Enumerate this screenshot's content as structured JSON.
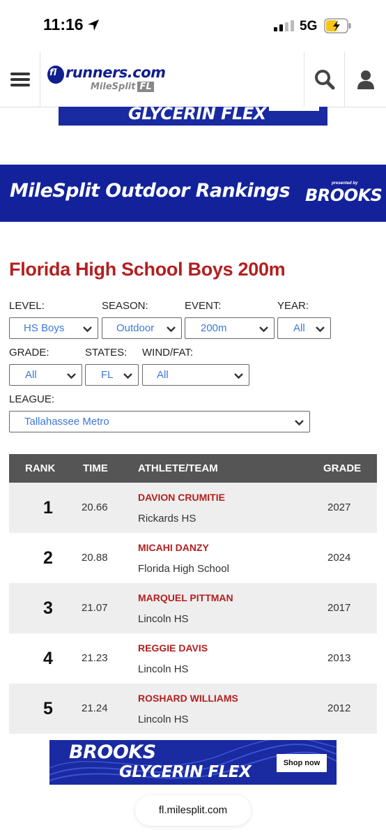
{
  "status_bar": {
    "time": "11:16",
    "network": "5G"
  },
  "header": {
    "logo_main": "runners.com",
    "logo_prefix": "fl",
    "logo_sub": "MileSplit",
    "logo_sub_badge": "FL"
  },
  "ad_top": {
    "text": "GLYCERIN FLEX"
  },
  "banner": {
    "title": "MileSplit Outdoor Rankings",
    "presented": "presented by",
    "brand": "BROOKS"
  },
  "page_title": "Florida High School Boys 200m",
  "filters": {
    "level": {
      "label": "LEVEL:",
      "value": "HS Boys"
    },
    "season": {
      "label": "SEASON:",
      "value": "Outdoor"
    },
    "event": {
      "label": "EVENT:",
      "value": "200m"
    },
    "year": {
      "label": "YEAR:",
      "value": "All"
    },
    "grade": {
      "label": "GRADE:",
      "value": "All"
    },
    "states": {
      "label": "STATES:",
      "value": "FL"
    },
    "wind": {
      "label": "WIND/FAT:",
      "value": "All"
    },
    "league": {
      "label": "LEAGUE:",
      "value": "Tallahassee Metro"
    }
  },
  "table": {
    "headers": {
      "rank": "RANK",
      "time": "TIME",
      "athlete": "ATHLETE/TEAM",
      "grade": "GRADE"
    },
    "rows": [
      {
        "rank": "1",
        "time": "20.66",
        "athlete": "DAVION CRUMITIE",
        "team": "Rickards HS",
        "grade": "2027"
      },
      {
        "rank": "2",
        "time": "20.88",
        "athlete": "MICAHI DANZY",
        "team": "Florida High School",
        "grade": "2024"
      },
      {
        "rank": "3",
        "time": "21.07",
        "athlete": "MARQUEL PITTMAN",
        "team": "Lincoln HS",
        "grade": "2017"
      },
      {
        "rank": "4",
        "time": "21.23",
        "athlete": "REGGIE DAVIS",
        "team": "Lincoln HS",
        "grade": "2013"
      },
      {
        "rank": "5",
        "time": "21.24",
        "athlete": "ROSHARD WILLIAMS",
        "team": "Lincoln HS",
        "grade": "2012"
      }
    ]
  },
  "ad_bottom": {
    "brand": "BROOKS",
    "product": "GLYCERIN FLEX",
    "cta": "Shop now"
  },
  "url_bar": {
    "url": "fl.milesplit.com"
  },
  "colors": {
    "brand_blue": "#13229b",
    "title_red": "#b31f1f",
    "header_gray": "#555555",
    "link_blue": "#3c78d8"
  }
}
